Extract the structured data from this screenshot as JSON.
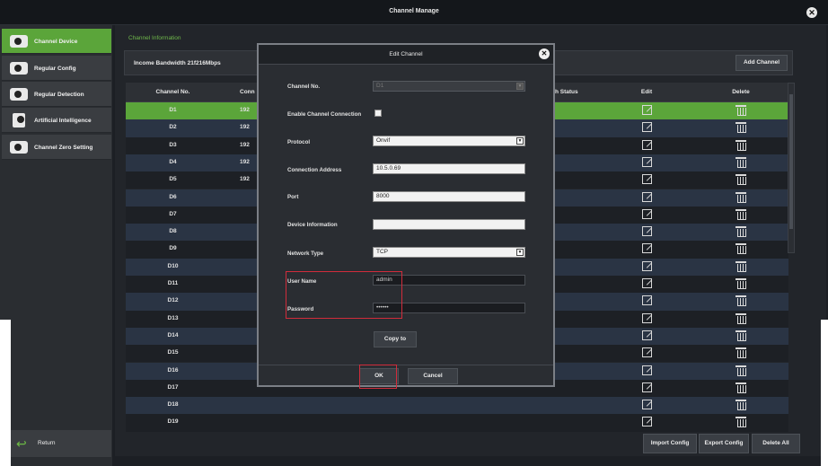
{
  "window": {
    "title": "Channel Manage"
  },
  "sidebar": {
    "items": [
      {
        "label": "Channel Device",
        "icon": "camera-icon",
        "active": true
      },
      {
        "label": "Regular Config",
        "icon": "camera-icon",
        "active": false
      },
      {
        "label": "Regular Detection",
        "icon": "camera-icon",
        "active": false
      },
      {
        "label": "Artificial Intelligence",
        "icon": "ai-icon",
        "active": false
      },
      {
        "label": "Channel Zero Setting",
        "icon": "camera-icon",
        "active": false
      }
    ],
    "return_label": "Return"
  },
  "main": {
    "section_title": "Channel Information",
    "bandwidth": "Income Bandwidth 21f216Mbps",
    "add_channel": "Add Channel",
    "columns": {
      "no": "Channel No.",
      "conn": "Conn",
      "status": "h Status",
      "edit": "Edit",
      "delete": "Delete"
    },
    "rows": [
      {
        "no": "D1",
        "ip": "192",
        "status": ""
      },
      {
        "no": "D2",
        "ip": "192",
        "status": ""
      },
      {
        "no": "D3",
        "ip": "192",
        "status": ""
      },
      {
        "no": "D4",
        "ip": "192",
        "status": ""
      },
      {
        "no": "D5",
        "ip": "192",
        "status": ""
      },
      {
        "no": "D6",
        "ip": "",
        "status": ""
      },
      {
        "no": "D7",
        "ip": "",
        "status": ""
      },
      {
        "no": "D8",
        "ip": "",
        "status": ""
      },
      {
        "no": "D9",
        "ip": "",
        "status": ""
      },
      {
        "no": "D10",
        "ip": "",
        "status": ""
      },
      {
        "no": "D11",
        "ip": "",
        "status": ""
      },
      {
        "no": "D12",
        "ip": "",
        "status": ""
      },
      {
        "no": "D13",
        "ip": "",
        "status": ""
      },
      {
        "no": "D14",
        "ip": "",
        "status": ""
      },
      {
        "no": "D15",
        "ip": "",
        "status": ""
      },
      {
        "no": "D16",
        "ip": "",
        "status": ""
      },
      {
        "no": "D17",
        "ip": "",
        "status": ""
      },
      {
        "no": "D18",
        "ip": "",
        "status": ""
      },
      {
        "no": "D19",
        "ip": "",
        "status": ""
      }
    ],
    "selected_row": "D1",
    "footer": {
      "import": "Import Config",
      "export": "Export Config",
      "delete_all": "Delete All"
    }
  },
  "dialog": {
    "title": "Edit Channel",
    "fields": {
      "channel_no": {
        "label": "Channel No.",
        "value": "D1"
      },
      "enable": {
        "label": "Enable Channel Connection"
      },
      "protocol": {
        "label": "Protocol",
        "value": "Onvif"
      },
      "address": {
        "label": "Connection Address",
        "value": "10.5.0.69"
      },
      "port": {
        "label": "Port",
        "value": "8000"
      },
      "device_info": {
        "label": "Device Information",
        "value": ""
      },
      "network": {
        "label": "Network Type",
        "value": "TCP"
      },
      "user": {
        "label": "User Name",
        "value": "admin"
      },
      "password": {
        "label": "Password",
        "value": "••••••"
      }
    },
    "copy_to": "Copy to",
    "ok": "OK",
    "cancel": "Cancel"
  },
  "colors": {
    "accent": "#5ba53a",
    "highlight": "#d12c3b"
  }
}
